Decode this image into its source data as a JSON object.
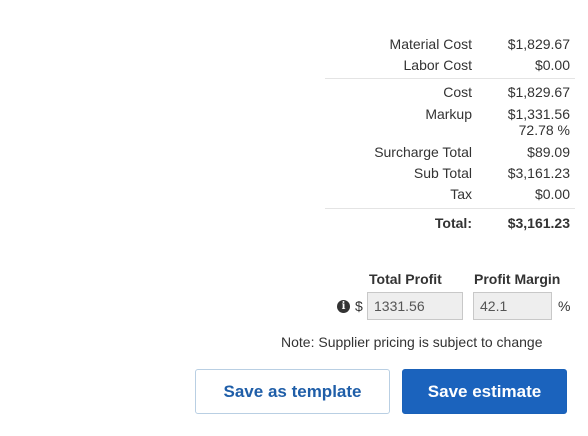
{
  "summary": {
    "material_cost": {
      "label": "Material Cost",
      "value": "$1,829.67"
    },
    "labor_cost": {
      "label": "Labor Cost",
      "value": "$0.00"
    },
    "cost": {
      "label": "Cost",
      "value": "$1,829.67"
    },
    "markup": {
      "label": "Markup",
      "value": "$1,331.56",
      "percent": "72.78 %"
    },
    "surcharge_total": {
      "label": "Surcharge Total",
      "value": "$89.09"
    },
    "sub_total": {
      "label": "Sub Total",
      "value": "$3,161.23"
    },
    "tax": {
      "label": "Tax",
      "value": "$0.00"
    },
    "total": {
      "label": "Total:",
      "value": "$3,161.23"
    }
  },
  "profit": {
    "total_profit_label": "Total Profit",
    "profit_margin_label": "Profit Margin",
    "currency_symbol": "$",
    "total_profit_value": "1331.56",
    "profit_margin_value": "42.1",
    "percent_symbol": "%",
    "info_icon": "info-icon"
  },
  "note": "Note: Supplier pricing is subject to change",
  "buttons": {
    "save_template": "Save as template",
    "save_estimate": "Save estimate"
  },
  "colors": {
    "primary": "#1b63bd",
    "secondary_text": "#1f5ea8",
    "field_bg": "#eeeeee"
  }
}
